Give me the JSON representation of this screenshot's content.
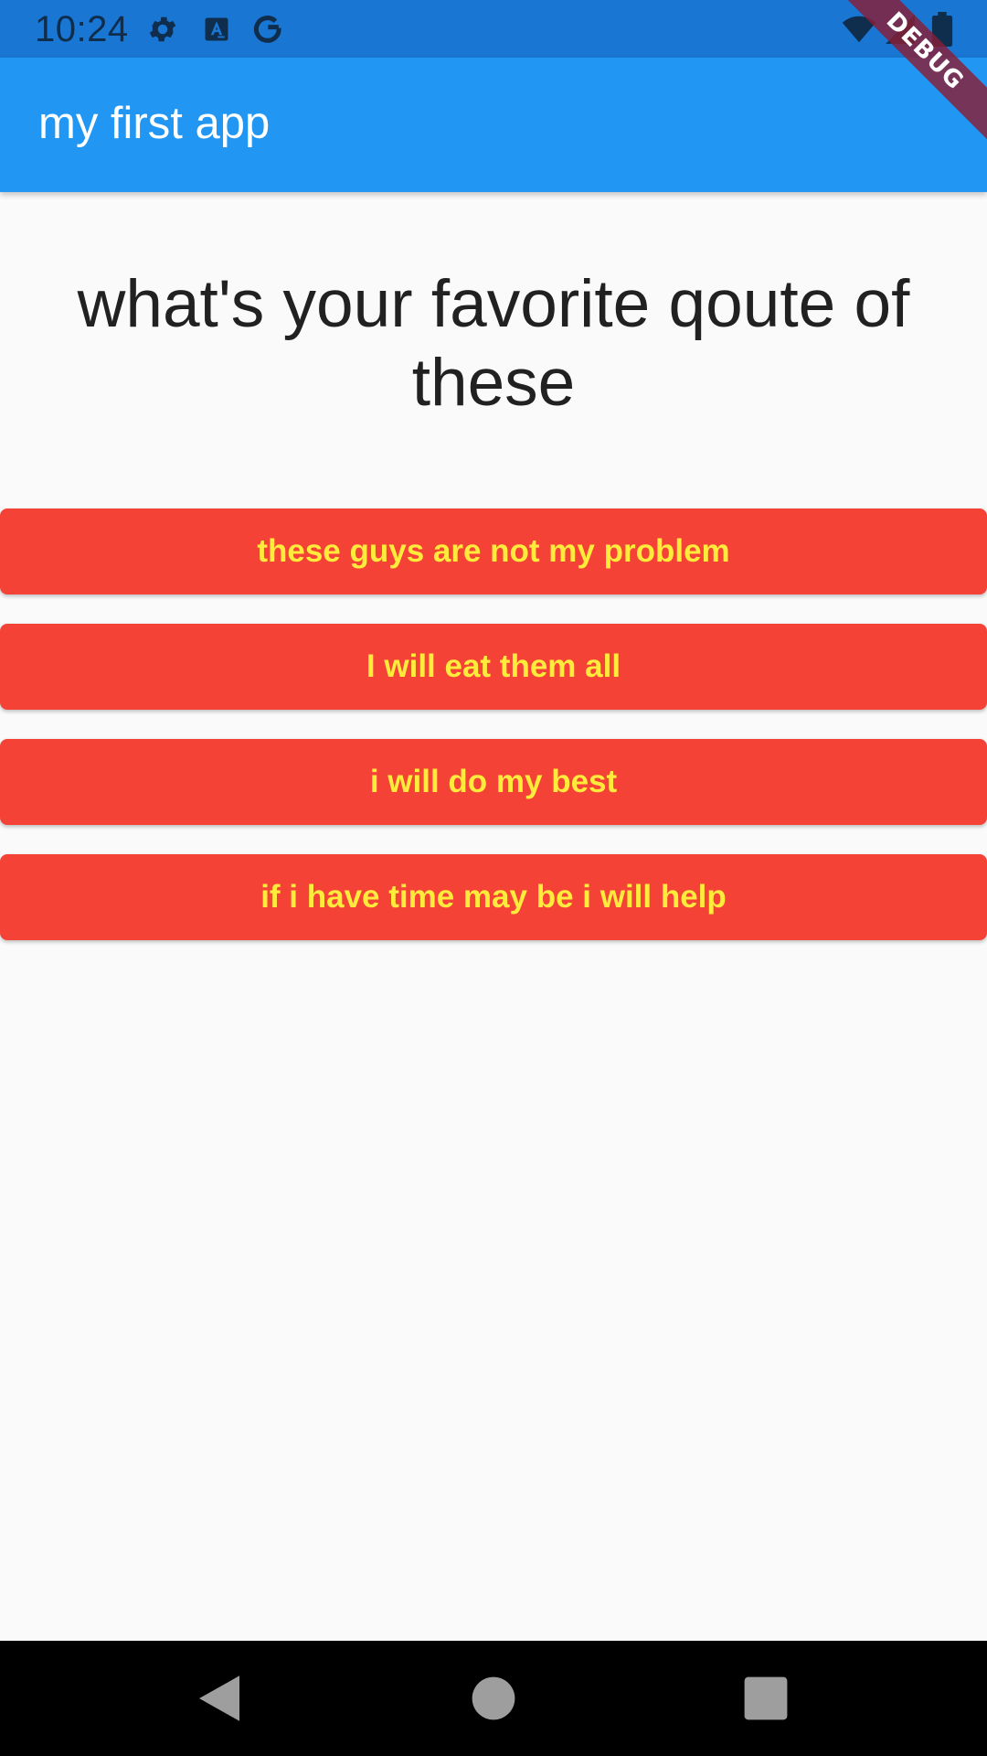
{
  "status_bar": {
    "time": "10:24",
    "icons": [
      "settings-icon",
      "text-a-icon",
      "google-icon",
      "wifi-icon",
      "signal-icon",
      "battery-icon"
    ],
    "color": "#1976d2"
  },
  "app_bar": {
    "title": "my first app",
    "color": "#2196f3"
  },
  "debug_banner": {
    "label": "DEBUG"
  },
  "main": {
    "question": "what's your favorite qoute of these",
    "answers": [
      {
        "label": "these guys are not my problem"
      },
      {
        "label": "I will eat them all"
      },
      {
        "label": "i will do my best"
      },
      {
        "label": "if i have time may be i will help"
      }
    ],
    "button_color": "#f44336",
    "button_text_color": "#ffeb3b"
  },
  "nav_bar": {
    "buttons": [
      "back-icon",
      "home-icon",
      "recents-icon"
    ]
  }
}
